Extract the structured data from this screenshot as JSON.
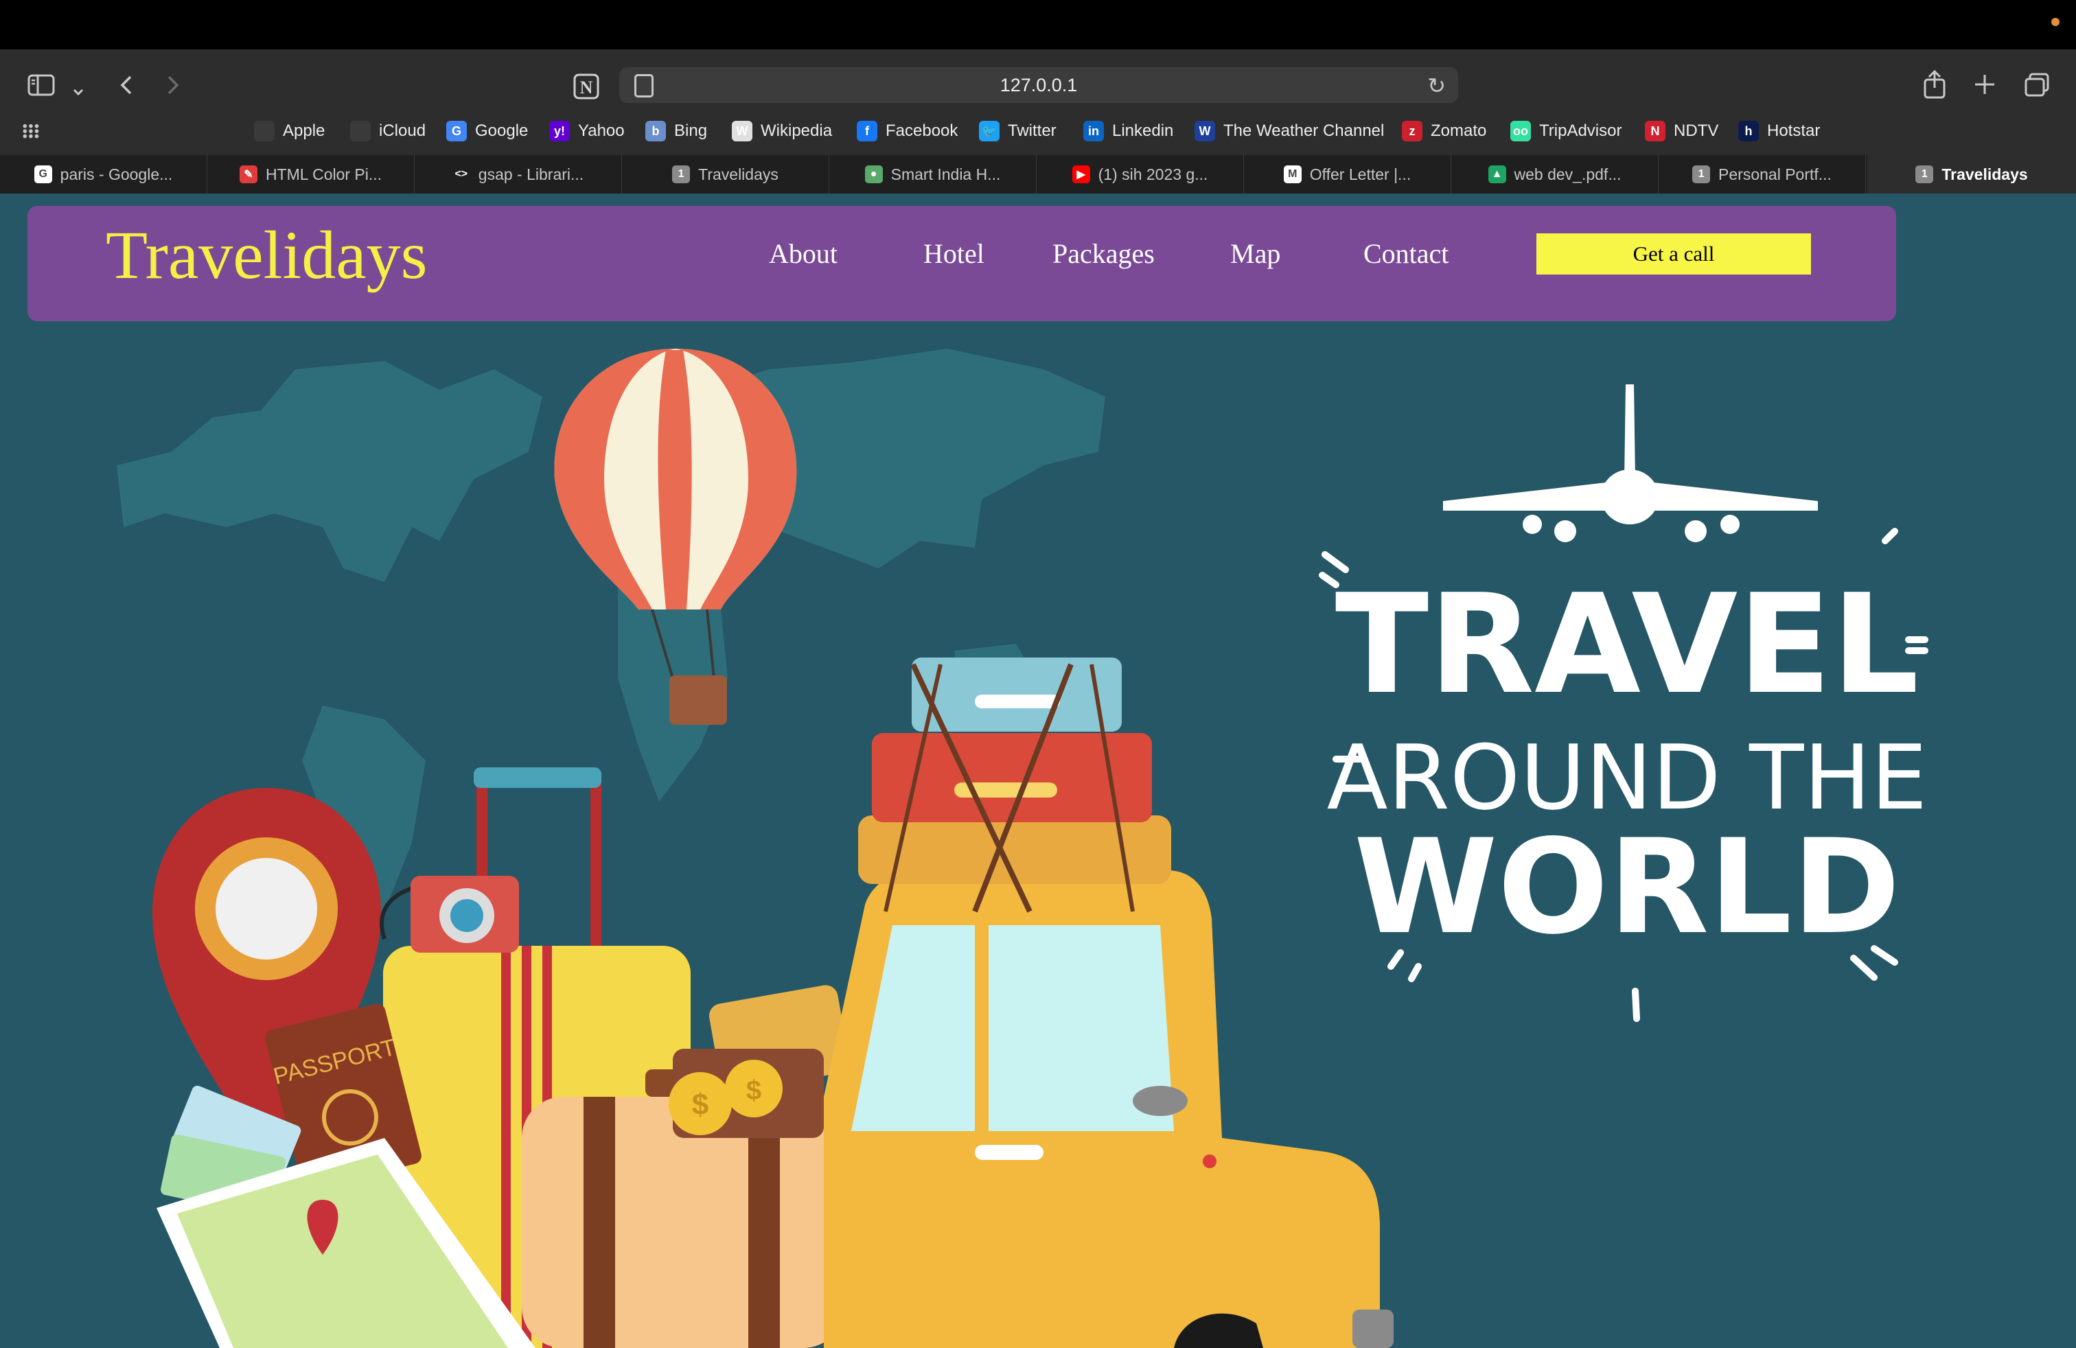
{
  "browser": {
    "url": "127.0.0.1",
    "bookmarks": [
      {
        "label": "Apple",
        "icon": "apple-icon",
        "color": "#3a3a3a"
      },
      {
        "label": "iCloud",
        "icon": "apple-icon",
        "color": "#3a3a3a"
      },
      {
        "label": "Google",
        "icon": "google-icon",
        "color": "#4285f4"
      },
      {
        "label": "Yahoo",
        "icon": "yahoo-icon",
        "color": "#5f01d1"
      },
      {
        "label": "Bing",
        "icon": "bing-icon",
        "color": "#6b8fcc"
      },
      {
        "label": "Wikipedia",
        "icon": "wikipedia-icon",
        "color": "#e0e0e0"
      },
      {
        "label": "Facebook",
        "icon": "facebook-icon",
        "color": "#1877f2"
      },
      {
        "label": "Twitter",
        "icon": "twitter-icon",
        "color": "#1da1f2"
      },
      {
        "label": "Linkedin",
        "icon": "linkedin-icon",
        "color": "#0a66c2"
      },
      {
        "label": "The Weather Channel",
        "icon": "weather-channel-icon",
        "color": "#1f3f9a"
      },
      {
        "label": "Zomato",
        "icon": "zomato-icon",
        "color": "#cb202d"
      },
      {
        "label": "TripAdvisor",
        "icon": "tripadvisor-icon",
        "color": "#34e0a1"
      },
      {
        "label": "NDTV",
        "icon": "ndtv-icon",
        "color": "#d1202f"
      },
      {
        "label": "Hotstar",
        "icon": "hotstar-icon",
        "color": "#0c1b4d"
      }
    ],
    "tabs": [
      {
        "label": "paris - Google...",
        "icon": "google-icon",
        "color": "#ffffff",
        "glyph": "G",
        "active": false
      },
      {
        "label": "HTML Color Pi...",
        "icon": "color-picker-icon",
        "color": "#e03c3c",
        "glyph": "✎",
        "active": false
      },
      {
        "label": "gsap - Librari...",
        "icon": "code-icon",
        "color": "transparent",
        "glyph": "<>",
        "active": false
      },
      {
        "label": "Travelidays",
        "icon": "page-icon",
        "color": "#8a8a8a",
        "glyph": "1",
        "active": false
      },
      {
        "label": "Smart India H...",
        "icon": "globe-icon",
        "color": "#5aa86a",
        "glyph": "●",
        "active": false
      },
      {
        "label": "(1) sih 2023 g...",
        "icon": "youtube-icon",
        "color": "#ff0000",
        "glyph": "▶",
        "active": false
      },
      {
        "label": "Offer Letter |...",
        "icon": "gmail-icon",
        "color": "#ffffff",
        "glyph": "M",
        "active": false
      },
      {
        "label": "web dev_.pdf...",
        "icon": "google-drive-icon",
        "color": "#1fa463",
        "glyph": "▲",
        "active": false
      },
      {
        "label": "Personal Portf...",
        "icon": "page-icon",
        "color": "#8a8a8a",
        "glyph": "1",
        "active": false
      },
      {
        "label": "Travelidays",
        "icon": "page-icon",
        "color": "#8a8a8a",
        "glyph": "1",
        "active": true
      }
    ]
  },
  "site": {
    "brand": "Travelidays",
    "nav": [
      "About",
      "Hotel",
      "Packages",
      "Map",
      "Contact"
    ],
    "cta": "Get a call",
    "hero": {
      "line1": "TRAVEL",
      "line2": "AROUND THE",
      "line3": "WORLD",
      "passport": "PASSPORT"
    }
  },
  "colors": {
    "page_bg": "#255766",
    "nav_bg": "#7a4a96",
    "brand": "#f4f046",
    "cta_bg": "#f7f545"
  }
}
